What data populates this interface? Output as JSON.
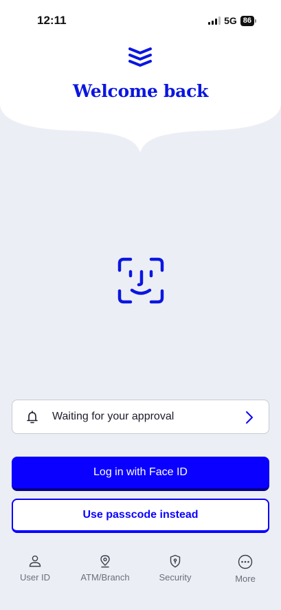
{
  "status_bar": {
    "time": "12:11",
    "network": "5G",
    "battery": "86"
  },
  "header": {
    "logo_icon": "bank-stack-logo-icon",
    "title": "Welcome back"
  },
  "face_id": {
    "icon": "face-id-icon"
  },
  "notification": {
    "text": "Waiting for your approval",
    "icon": "bell-icon",
    "action_icon": "chevron-right-icon"
  },
  "actions": {
    "primary_label": "Log in with Face ID",
    "secondary_label": "Use passcode instead"
  },
  "tabbar": {
    "items": [
      {
        "label": "User ID",
        "icon": "user-icon"
      },
      {
        "label": "ATM/Branch",
        "icon": "location-pin-icon"
      },
      {
        "label": "Security",
        "icon": "shield-lock-icon"
      },
      {
        "label": "More",
        "icon": "more-dots-icon"
      }
    ]
  },
  "colors": {
    "brand_blue": "#0a00ff",
    "title_blue": "#0a16e0",
    "background": "#eceef5"
  }
}
